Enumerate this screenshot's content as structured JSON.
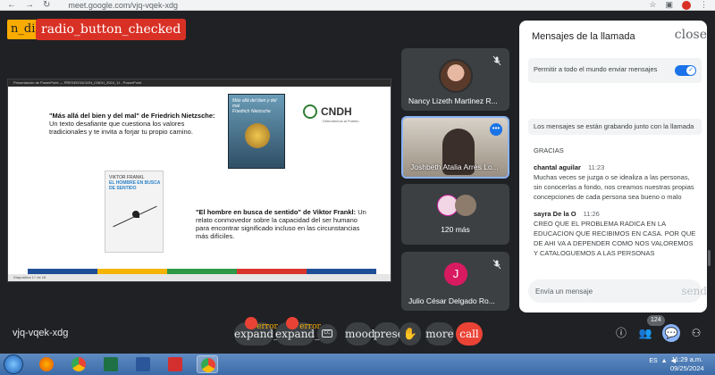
{
  "browser": {
    "url": "meet.google.com/vjq-vqek-xdg"
  },
  "overlays": {
    "id_chip": "n_di",
    "radio_chip": "radio_button_checked"
  },
  "presentation": {
    "window_title": "Presentación de PowerPoint — PRESENTACION_CNDH_2024_11 - PowerPoint",
    "status_text": "Diapositiva 17 de 18",
    "quote1_bold": "\"Más allá del bien y del mal\" de Friedrich Nietzsche:",
    "quote1_text": " Un texto desafiante que cuestiona los valores tradicionales y te invita a forjar tu propio camino.",
    "quote2_bold": "\"El hombre en busca de sentido\" de Viktor Frankl:",
    "quote2_text": " Un relato conmovedor sobre la capacidad del ser humano para encontrar significado incluso en las circunstancias más difíciles.",
    "book1_title": "Más allá del bien y del mal",
    "book1_author": "Friedrich Nietzsche",
    "book2_author": "VIKTOR FRANKL",
    "book2_title": "EL HOMBRE EN BUSCA DE SENTIDO",
    "logo_text": "CNDH",
    "logo_sub": "Defendemos al Pueblo",
    "stripe_colors": [
      "#1f4e96",
      "#f5b400",
      "#2e9a48",
      "#d9342b",
      "#1f4e96"
    ]
  },
  "participants": [
    {
      "name": "Nancy Lizeth Martinez R..."
    },
    {
      "name": "Joshbeth Atalia Arres Lo..."
    },
    {
      "count": "120 más"
    },
    {
      "name": "Julio César Delgado Ro...",
      "initial": "J"
    }
  ],
  "chat": {
    "title": "Mensajes de la llamada",
    "close_label": "close",
    "allow_label": "Permitir a todo el mundo enviar mensajes",
    "toggle_check": "✓",
    "recording_notice": "Los mensajes se están grabando junto con la llamada",
    "messages": [
      {
        "text": "GRACIAS"
      },
      {
        "sender": "chantal aguilar",
        "time": "11:23",
        "text": "Muchas veces se juzga o se idealiza a las personas, sin conocerlas a fondo, nos creamos nuestras propias concepciones de cada persona sea bueno o malo"
      },
      {
        "sender": "sayra De la O",
        "time": "11:26",
        "text": "CREO QUE EL PROBLEMA RADICA EN LA EDUCACION QUE RECIBIMOS EN CASA. POR QUE DE AHI VA A DEPENDER COMO NOS VALOREMOS Y CATALOGUEMOS A LAS PERSONAS"
      }
    ],
    "input_placeholder": "Envía un mensaje",
    "send_label": "send"
  },
  "controls": {
    "meeting_code": "vjq-vqek-xdg",
    "mic_label": "expand_l",
    "cam_label": "expand_l",
    "error_label": "error",
    "cc_label": "CC",
    "mood_label": "mood",
    "present_label": "prese",
    "hand_label": "✋",
    "more_label": "more",
    "call_label": "call",
    "info_icon": "ⓘ",
    "people_icon": "👥",
    "chat_icon": "💬",
    "activities_icon": "⚇",
    "people_count": "124"
  },
  "taskbar": {
    "lang": "ES",
    "time": "11:29 a.m.",
    "date": "09/25/2024"
  }
}
